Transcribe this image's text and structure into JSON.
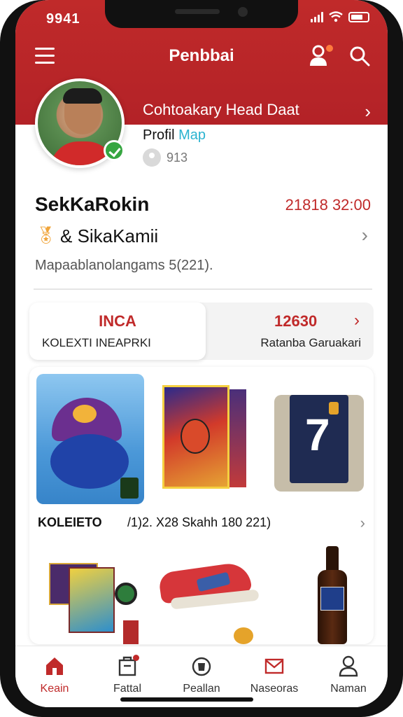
{
  "status_bar": {
    "time": "9941"
  },
  "header": {
    "title": "Penbbai",
    "profile_link_label": "Cohtoakary Head Daat",
    "colors": {
      "brand": "#c02a2a",
      "link_accent": "#2ab3d0"
    }
  },
  "profile": {
    "map_label_prefix": "Profil ",
    "map_label_accent": "Map",
    "count": "913"
  },
  "user": {
    "name": "SekKaRokin",
    "timestamp": "21818 32:00",
    "tag_label": "& SikaKamii",
    "info": "Mapaablanolangams 5(221)."
  },
  "stats": {
    "left_value": "INCA",
    "left_label": "KOLEXTI INEAPRKI",
    "right_value": "12630",
    "right_label": "Ratanba Garuakari"
  },
  "collection": {
    "title": "KOLEIETO",
    "meta": "/1)2.  X28 Skahh 180  221)"
  },
  "bottom_nav": {
    "items": [
      {
        "label": "Keain",
        "icon": "home-icon"
      },
      {
        "label": "Fattal",
        "icon": "store-icon"
      },
      {
        "label": "Peallan",
        "icon": "bag-icon"
      },
      {
        "label": "Naseoras",
        "icon": "mail-icon"
      },
      {
        "label": "Naman",
        "icon": "user-icon"
      }
    ]
  }
}
